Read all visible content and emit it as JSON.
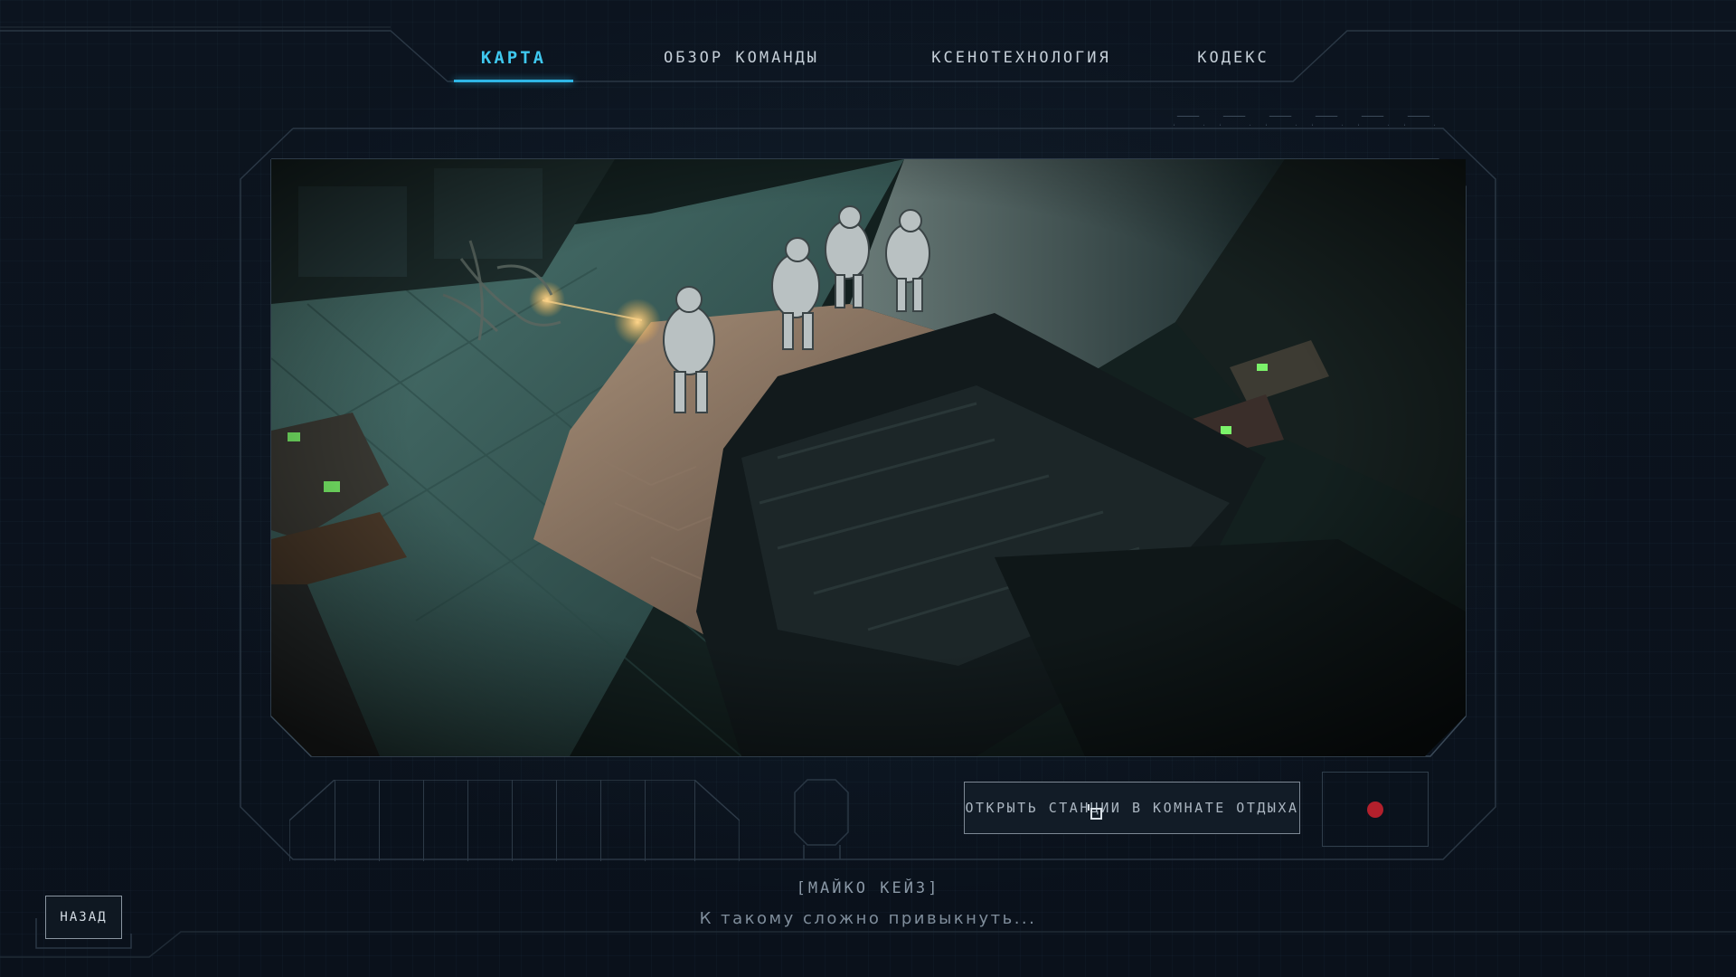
{
  "tabs": [
    {
      "label": "КАРТА",
      "active": true
    },
    {
      "label": "ОБЗОР КОМАНДЫ",
      "active": false
    },
    {
      "label": "КСЕНОТЕХНОЛОГИЯ",
      "active": false
    },
    {
      "label": "КОДЕКС",
      "active": false
    }
  ],
  "scene": {
    "description_icon": "cutscene-viewport"
  },
  "action": {
    "label": "ОТКРЫТЬ СТАНЦИИ В КОМНАТЕ ОТДЫХА"
  },
  "record_indicator": {
    "color": "#b3202c",
    "icon": "record-dot-icon"
  },
  "dialogue": {
    "speaker": "[МАЙКО КЕЙЗ]",
    "line": "К такому сложно привыкнуть..."
  },
  "back": {
    "label": "НАЗАД"
  },
  "colors": {
    "accent": "#3fc8ef",
    "frame": "#2d3a47",
    "background": "#0b121c"
  }
}
